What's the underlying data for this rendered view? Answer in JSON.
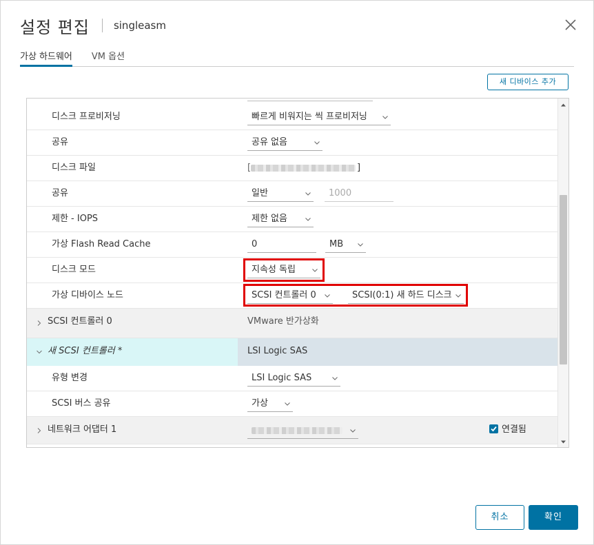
{
  "header": {
    "title": "설정 편집",
    "vm_name": "singleasm"
  },
  "tabs": [
    {
      "label": "가상 하드웨어",
      "active": true
    },
    {
      "label": "VM 옵션",
      "active": false
    }
  ],
  "add_device_label": "새 디바이스 추가",
  "rows": {
    "provisioning": {
      "label": "디스크 프로비저닝",
      "value": "빠르게 비워지는 씩 프로비저닝"
    },
    "sharing": {
      "label": "공유",
      "value": "공유 없음"
    },
    "disk_file": {
      "label": "디스크 파일",
      "value_suffix": "]"
    },
    "shares": {
      "label": "공유",
      "value": "일반",
      "input": "1000"
    },
    "iops": {
      "label": "제한 - IOPS",
      "value": "제한 없음"
    },
    "flash_cache": {
      "label": "가상 Flash Read Cache",
      "value": "0",
      "unit": "MB"
    },
    "disk_mode": {
      "label": "디스크 모드",
      "value": "지속성 독립"
    },
    "vdev_node": {
      "label": "가상 디바이스 노드",
      "controller": "SCSI 컨트롤러 0",
      "node": "SCSI(0:1) 새 하드 디스크"
    },
    "scsi0": {
      "label": "SCSI 컨트롤러 0",
      "value": "VMware 반가상화"
    },
    "new_scsi": {
      "label": "새 SCSI 컨트롤러 *",
      "value": "LSI Logic SAS"
    },
    "change_type": {
      "label": "유형 변경",
      "value": "LSI Logic SAS"
    },
    "bus_sharing": {
      "label": "SCSI 버스 공유",
      "value": "가상"
    },
    "nic1": {
      "label": "네트워크 어댑터 1",
      "connected_label": "연결됨"
    }
  },
  "footer": {
    "cancel_label": "취소",
    "ok_label": "확인"
  },
  "colors": {
    "accent": "#0072a3",
    "highlight": "#e00000",
    "selected_left": "#d9f6f7",
    "selected_right": "#d9e3ea"
  }
}
